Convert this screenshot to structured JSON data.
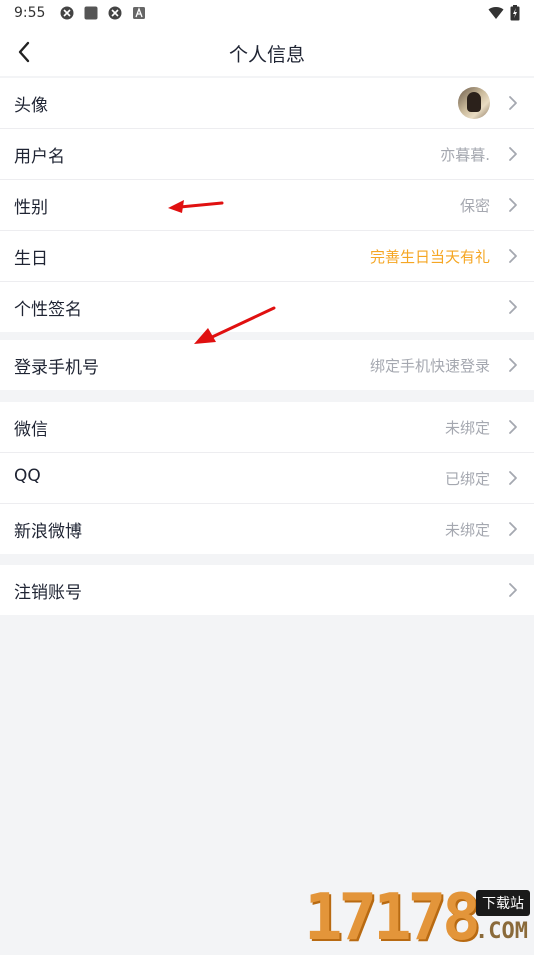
{
  "status_bar": {
    "time": "9:55"
  },
  "header": {
    "title": "个人信息"
  },
  "profile_section": [
    {
      "label": "头像",
      "value": "",
      "type": "avatar"
    },
    {
      "label": "用户名",
      "value": "亦暮暮."
    },
    {
      "label": "性别",
      "value": "保密"
    },
    {
      "label": "生日",
      "value": "完善生日当天有礼",
      "highlight": true
    },
    {
      "label": "个性签名",
      "value": ""
    }
  ],
  "phone_section": [
    {
      "label": "登录手机号",
      "value": "绑定手机快速登录"
    }
  ],
  "social_section": [
    {
      "label": "微信",
      "value": "未绑定"
    },
    {
      "label": "QQ",
      "value": "已绑定"
    },
    {
      "label": "新浪微博",
      "value": "未绑定"
    }
  ],
  "account_section": [
    {
      "label": "注销账号",
      "value": ""
    }
  ],
  "watermark": {
    "number": "17178",
    "tag": "下载站",
    "suffix": ".COM"
  },
  "colors": {
    "highlight": "#f5a623",
    "annotation_arrow": "#e01010",
    "background": "#f3f4f6"
  }
}
